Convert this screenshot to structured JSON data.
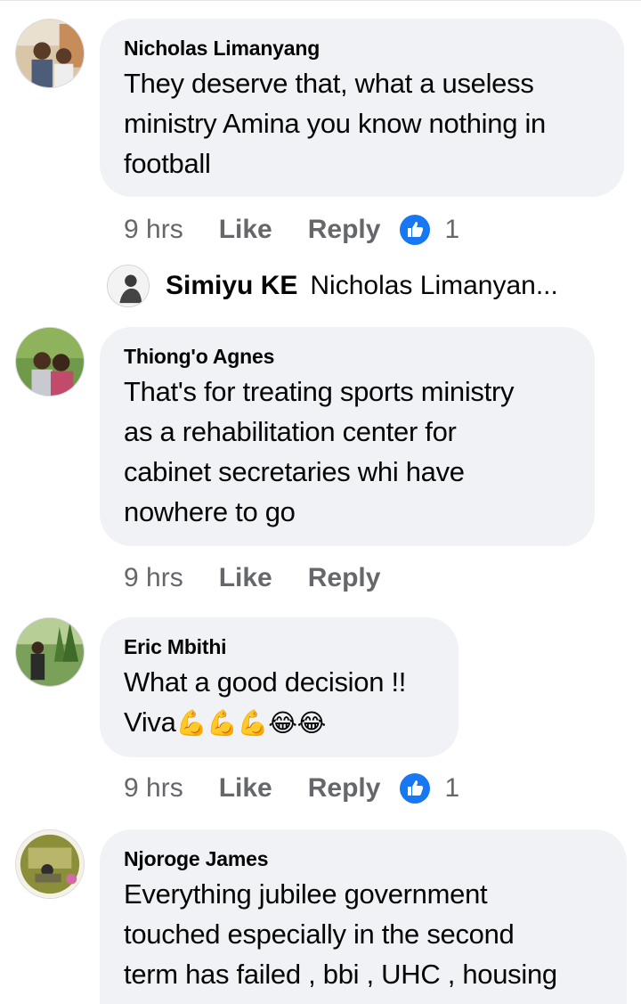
{
  "comments": [
    {
      "author": "Nicholas Limanyang",
      "text_lines": [
        "They deserve that, what a useless",
        "ministry Amina you know nothing in",
        "football"
      ],
      "time": "9 hrs",
      "like_label": "Like",
      "reply_label": "Reply",
      "reaction_count": "1"
    },
    {
      "author": "Thiong'o Agnes",
      "text_lines": [
        "That's for treating sports ministry",
        "as a rehabilitation center for",
        "cabinet secretaries whi have",
        "nowhere to go"
      ],
      "time": "9 hrs",
      "like_label": "Like",
      "reply_label": "Reply"
    },
    {
      "author": "Eric Mbithi",
      "text_lines": [
        "What a good decision !!"
      ],
      "text_line2_prefix": "Viva",
      "text_line2_emojis": "💪💪💪😂😂",
      "time": "9 hrs",
      "like_label": "Like",
      "reply_label": "Reply",
      "reaction_count": "1"
    },
    {
      "author": "Njoroge James",
      "text_lines": [
        "Everything jubilee government",
        "touched especially in the second",
        "term has failed , bbi , UHC , housing"
      ]
    }
  ],
  "reply_preview": {
    "author": "Simiyu KE",
    "preview": "Nicholas Limanyan..."
  },
  "colors": {
    "bubble": "#f0f2f5",
    "secondary_text": "#65676b",
    "like_blue": "#1877f2"
  },
  "icons": {
    "reaction": "like-thumbs-up-icon"
  }
}
